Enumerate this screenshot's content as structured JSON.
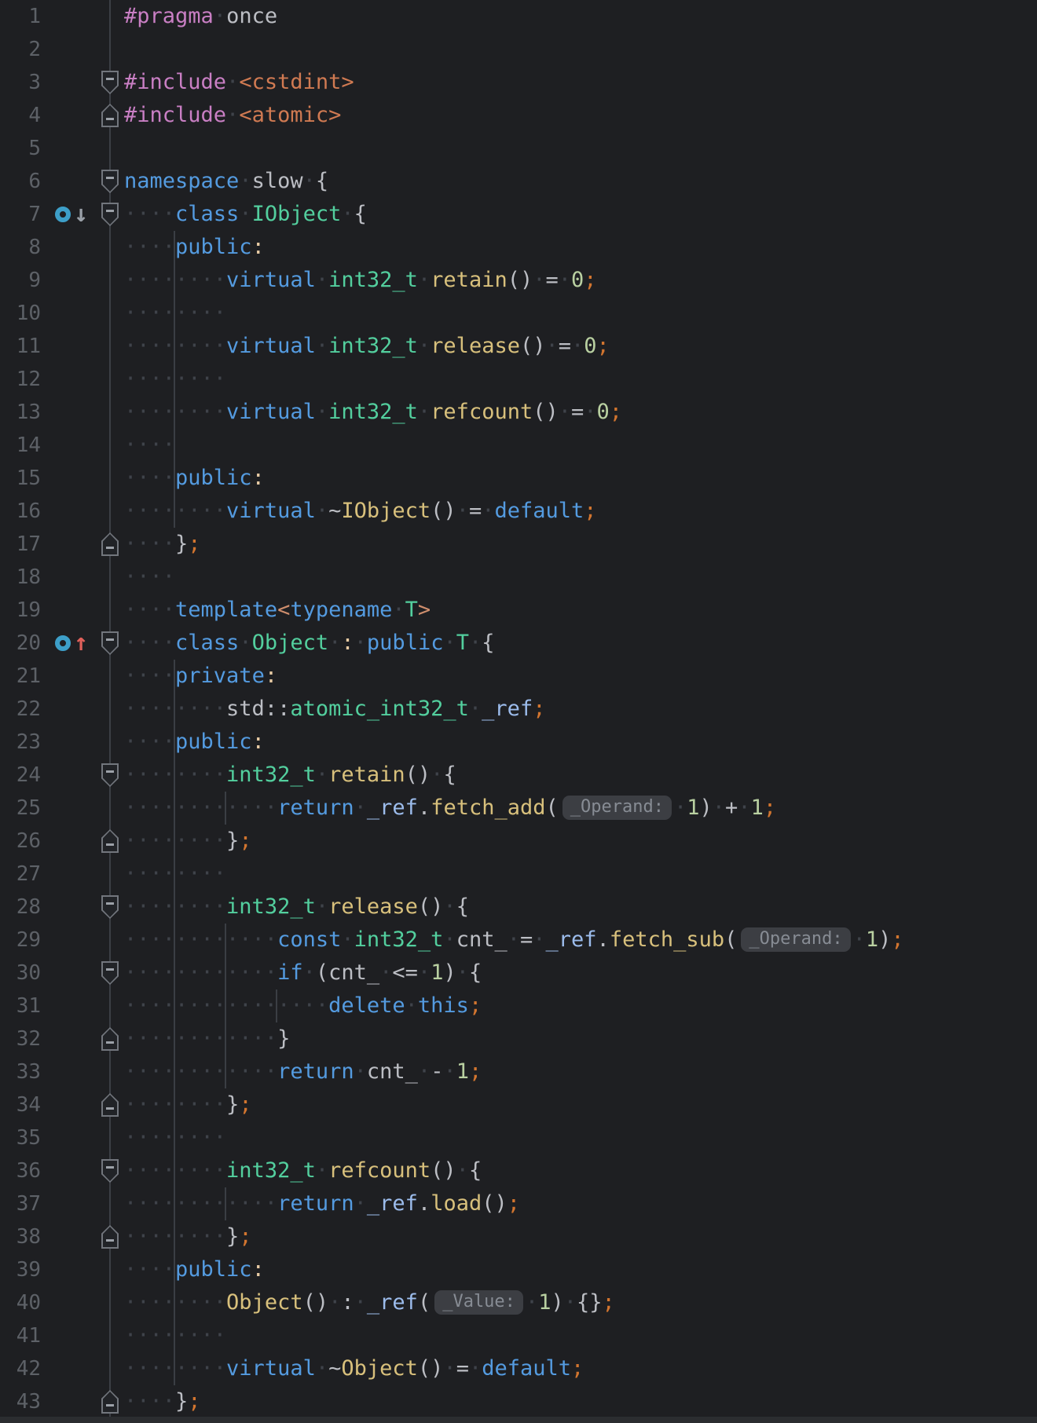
{
  "editor": {
    "background": "#1e1f22",
    "token_colors": {
      "def": "#bcbec4",
      "kw": "#549be0",
      "ty": "#53cf9e",
      "fn": "#d8c07c",
      "fi": "#9cbcec",
      "pp": "#c97fc4",
      "inc": "#d07a52",
      "num": "#b9d0a1",
      "semi": "#d2752f",
      "pun": "#e8cba4",
      "ang": "#cf8e6d",
      "ws": "#3f434a"
    },
    "ui_colors": {
      "line_number": "#5d6167",
      "gutter_line": "#3c3f45",
      "indent_guide": "#3a3e44",
      "fold_border": "#72767d",
      "fold_fill": "#212327",
      "fold_minus": "#9ca1a8",
      "hint_bg": "#3c3e43",
      "hint_fg": "#878c94",
      "implemented_circle": "#3d9fc9",
      "arrow_down": "#9aa0a8",
      "arrow_up": "#e0605a",
      "bottom_bar": "#2b2d30"
    },
    "indent_guides": [
      {
        "col": 4,
        "from": 8,
        "to": 16
      },
      {
        "col": 4,
        "from": 21,
        "to": 42
      },
      {
        "col": 8,
        "from": 25,
        "to": 25
      },
      {
        "col": 8,
        "from": 29,
        "to": 33
      },
      {
        "col": 8,
        "from": 37,
        "to": 37
      },
      {
        "col": 12,
        "from": 31,
        "to": 31
      }
    ],
    "lines": [
      {
        "n": 1,
        "fold": null,
        "icon": null,
        "tokens": [
          [
            "pp",
            "#pragma"
          ],
          [
            "def",
            " once"
          ]
        ]
      },
      {
        "n": 2,
        "fold": null,
        "icon": null,
        "tokens": []
      },
      {
        "n": 3,
        "fold": "down",
        "icon": null,
        "tokens": [
          [
            "pp",
            "#include"
          ],
          [
            "def",
            " "
          ],
          [
            "inc",
            "<cstdint>"
          ]
        ]
      },
      {
        "n": 4,
        "fold": "up",
        "icon": null,
        "tokens": [
          [
            "pp",
            "#include"
          ],
          [
            "def",
            " "
          ],
          [
            "inc",
            "<atomic>"
          ]
        ]
      },
      {
        "n": 5,
        "fold": null,
        "icon": null,
        "tokens": []
      },
      {
        "n": 6,
        "fold": "down",
        "icon": null,
        "tokens": [
          [
            "kw",
            "namespace"
          ],
          [
            "def",
            " slow {"
          ]
        ]
      },
      {
        "n": 7,
        "fold": "down",
        "icon": "down",
        "tokens": [
          [
            "def",
            "    "
          ],
          [
            "kw",
            "class"
          ],
          [
            "def",
            " "
          ],
          [
            "ty",
            "IObject"
          ],
          [
            "def",
            " {"
          ]
        ]
      },
      {
        "n": 8,
        "fold": null,
        "icon": null,
        "tokens": [
          [
            "def",
            "    "
          ],
          [
            "kw",
            "public"
          ],
          [
            "pun",
            ":"
          ]
        ]
      },
      {
        "n": 9,
        "fold": null,
        "icon": null,
        "tokens": [
          [
            "def",
            "        "
          ],
          [
            "kw",
            "virtual"
          ],
          [
            "def",
            " "
          ],
          [
            "ty",
            "int32_t"
          ],
          [
            "def",
            " "
          ],
          [
            "fn",
            "retain"
          ],
          [
            "def",
            "() = "
          ],
          [
            "num",
            "0"
          ],
          [
            "semi",
            ";"
          ]
        ]
      },
      {
        "n": 10,
        "fold": null,
        "icon": null,
        "tokens": [
          [
            "def",
            "        "
          ]
        ]
      },
      {
        "n": 11,
        "fold": null,
        "icon": null,
        "tokens": [
          [
            "def",
            "        "
          ],
          [
            "kw",
            "virtual"
          ],
          [
            "def",
            " "
          ],
          [
            "ty",
            "int32_t"
          ],
          [
            "def",
            " "
          ],
          [
            "fn",
            "release"
          ],
          [
            "def",
            "() = "
          ],
          [
            "num",
            "0"
          ],
          [
            "semi",
            ";"
          ]
        ]
      },
      {
        "n": 12,
        "fold": null,
        "icon": null,
        "tokens": [
          [
            "def",
            "        "
          ]
        ]
      },
      {
        "n": 13,
        "fold": null,
        "icon": null,
        "tokens": [
          [
            "def",
            "        "
          ],
          [
            "kw",
            "virtual"
          ],
          [
            "def",
            " "
          ],
          [
            "ty",
            "int32_t"
          ],
          [
            "def",
            " "
          ],
          [
            "fn",
            "refcount"
          ],
          [
            "def",
            "() = "
          ],
          [
            "num",
            "0"
          ],
          [
            "semi",
            ";"
          ]
        ]
      },
      {
        "n": 14,
        "fold": null,
        "icon": null,
        "tokens": [
          [
            "def",
            "    "
          ]
        ]
      },
      {
        "n": 15,
        "fold": null,
        "icon": null,
        "tokens": [
          [
            "def",
            "    "
          ],
          [
            "kw",
            "public"
          ],
          [
            "pun",
            ":"
          ]
        ]
      },
      {
        "n": 16,
        "fold": null,
        "icon": null,
        "tokens": [
          [
            "def",
            "        "
          ],
          [
            "kw",
            "virtual"
          ],
          [
            "def",
            " ~"
          ],
          [
            "fn",
            "IObject"
          ],
          [
            "def",
            "() = "
          ],
          [
            "kw",
            "default"
          ],
          [
            "semi",
            ";"
          ]
        ]
      },
      {
        "n": 17,
        "fold": "up",
        "icon": null,
        "tokens": [
          [
            "def",
            "    }"
          ],
          [
            "semi",
            ";"
          ]
        ]
      },
      {
        "n": 18,
        "fold": null,
        "icon": null,
        "tokens": [
          [
            "def",
            "    "
          ]
        ]
      },
      {
        "n": 19,
        "fold": null,
        "icon": null,
        "tokens": [
          [
            "def",
            "    "
          ],
          [
            "kw",
            "template"
          ],
          [
            "ang",
            "<"
          ],
          [
            "kw",
            "typename"
          ],
          [
            "def",
            " "
          ],
          [
            "ty",
            "T"
          ],
          [
            "ang",
            ">"
          ]
        ]
      },
      {
        "n": 20,
        "fold": "down",
        "icon": "up",
        "tokens": [
          [
            "def",
            "    "
          ],
          [
            "kw",
            "class"
          ],
          [
            "def",
            " "
          ],
          [
            "ty",
            "Object"
          ],
          [
            "def",
            " "
          ],
          [
            "pun",
            ":"
          ],
          [
            "def",
            " "
          ],
          [
            "kw",
            "public"
          ],
          [
            "def",
            " "
          ],
          [
            "ty",
            "T"
          ],
          [
            "def",
            " {"
          ]
        ]
      },
      {
        "n": 21,
        "fold": null,
        "icon": null,
        "tokens": [
          [
            "def",
            "    "
          ],
          [
            "kw",
            "private"
          ],
          [
            "pun",
            ":"
          ]
        ]
      },
      {
        "n": 22,
        "fold": null,
        "icon": null,
        "tokens": [
          [
            "def",
            "        std::"
          ],
          [
            "ty",
            "atomic_int32_t"
          ],
          [
            "def",
            " "
          ],
          [
            "fi",
            "_ref"
          ],
          [
            "semi",
            ";"
          ]
        ]
      },
      {
        "n": 23,
        "fold": null,
        "icon": null,
        "tokens": [
          [
            "def",
            "    "
          ],
          [
            "kw",
            "public"
          ],
          [
            "pun",
            ":"
          ]
        ]
      },
      {
        "n": 24,
        "fold": "down",
        "icon": null,
        "tokens": [
          [
            "def",
            "        "
          ],
          [
            "ty",
            "int32_t"
          ],
          [
            "def",
            " "
          ],
          [
            "fn",
            "retain"
          ],
          [
            "def",
            "() {"
          ]
        ]
      },
      {
        "n": 25,
        "fold": null,
        "icon": null,
        "tokens": [
          [
            "def",
            "            "
          ],
          [
            "kw",
            "return"
          ],
          [
            "def",
            " "
          ],
          [
            "fi",
            "_ref"
          ],
          [
            "def",
            "."
          ],
          [
            "fn",
            "fetch_add"
          ],
          [
            "def",
            "("
          ],
          [
            "hint",
            "_Operand:"
          ],
          [
            "def",
            " "
          ],
          [
            "num",
            "1"
          ],
          [
            "def",
            ") + "
          ],
          [
            "num",
            "1"
          ],
          [
            "semi",
            ";"
          ]
        ]
      },
      {
        "n": 26,
        "fold": "up",
        "icon": null,
        "tokens": [
          [
            "def",
            "        }"
          ],
          [
            "semi",
            ";"
          ]
        ]
      },
      {
        "n": 27,
        "fold": null,
        "icon": null,
        "tokens": [
          [
            "def",
            "        "
          ]
        ]
      },
      {
        "n": 28,
        "fold": "down",
        "icon": null,
        "tokens": [
          [
            "def",
            "        "
          ],
          [
            "ty",
            "int32_t"
          ],
          [
            "def",
            " "
          ],
          [
            "fn",
            "release"
          ],
          [
            "def",
            "() {"
          ]
        ]
      },
      {
        "n": 29,
        "fold": null,
        "icon": null,
        "tokens": [
          [
            "def",
            "            "
          ],
          [
            "kw",
            "const"
          ],
          [
            "def",
            " "
          ],
          [
            "ty",
            "int32_t"
          ],
          [
            "def",
            " cnt_ = "
          ],
          [
            "fi",
            "_ref"
          ],
          [
            "def",
            "."
          ],
          [
            "fn",
            "fetch_sub"
          ],
          [
            "def",
            "("
          ],
          [
            "hint",
            "_Operand:"
          ],
          [
            "def",
            " "
          ],
          [
            "num",
            "1"
          ],
          [
            "def",
            ")"
          ],
          [
            "semi",
            ";"
          ]
        ]
      },
      {
        "n": 30,
        "fold": "down",
        "icon": null,
        "tokens": [
          [
            "def",
            "            "
          ],
          [
            "kw",
            "if"
          ],
          [
            "def",
            " (cnt_ <= "
          ],
          [
            "num",
            "1"
          ],
          [
            "def",
            ") {"
          ]
        ]
      },
      {
        "n": 31,
        "fold": null,
        "icon": null,
        "tokens": [
          [
            "def",
            "                "
          ],
          [
            "kw",
            "delete"
          ],
          [
            "def",
            " "
          ],
          [
            "kw",
            "this"
          ],
          [
            "semi",
            ";"
          ]
        ]
      },
      {
        "n": 32,
        "fold": "up",
        "icon": null,
        "tokens": [
          [
            "def",
            "            }"
          ]
        ]
      },
      {
        "n": 33,
        "fold": null,
        "icon": null,
        "tokens": [
          [
            "def",
            "            "
          ],
          [
            "kw",
            "return"
          ],
          [
            "def",
            " cnt_ - "
          ],
          [
            "num",
            "1"
          ],
          [
            "semi",
            ";"
          ]
        ]
      },
      {
        "n": 34,
        "fold": "up",
        "icon": null,
        "tokens": [
          [
            "def",
            "        }"
          ],
          [
            "semi",
            ";"
          ]
        ]
      },
      {
        "n": 35,
        "fold": null,
        "icon": null,
        "tokens": [
          [
            "def",
            "        "
          ]
        ]
      },
      {
        "n": 36,
        "fold": "down",
        "icon": null,
        "tokens": [
          [
            "def",
            "        "
          ],
          [
            "ty",
            "int32_t"
          ],
          [
            "def",
            " "
          ],
          [
            "fn",
            "refcount"
          ],
          [
            "def",
            "() {"
          ]
        ]
      },
      {
        "n": 37,
        "fold": null,
        "icon": null,
        "tokens": [
          [
            "def",
            "            "
          ],
          [
            "kw",
            "return"
          ],
          [
            "def",
            " "
          ],
          [
            "fi",
            "_ref"
          ],
          [
            "def",
            "."
          ],
          [
            "fn",
            "load"
          ],
          [
            "def",
            "()"
          ],
          [
            "semi",
            ";"
          ]
        ]
      },
      {
        "n": 38,
        "fold": "up",
        "icon": null,
        "tokens": [
          [
            "def",
            "        }"
          ],
          [
            "semi",
            ";"
          ]
        ]
      },
      {
        "n": 39,
        "fold": null,
        "icon": null,
        "tokens": [
          [
            "def",
            "    "
          ],
          [
            "kw",
            "public"
          ],
          [
            "pun",
            ":"
          ]
        ]
      },
      {
        "n": 40,
        "fold": null,
        "icon": null,
        "tokens": [
          [
            "def",
            "        "
          ],
          [
            "fn",
            "Object"
          ],
          [
            "def",
            "() : "
          ],
          [
            "fi",
            "_ref"
          ],
          [
            "def",
            "("
          ],
          [
            "hint",
            "_Value:"
          ],
          [
            "def",
            " "
          ],
          [
            "num",
            "1"
          ],
          [
            "def",
            ") {}"
          ],
          [
            "semi",
            ";"
          ]
        ]
      },
      {
        "n": 41,
        "fold": null,
        "icon": null,
        "tokens": [
          [
            "def",
            "        "
          ]
        ]
      },
      {
        "n": 42,
        "fold": null,
        "icon": null,
        "tokens": [
          [
            "def",
            "        "
          ],
          [
            "kw",
            "virtual"
          ],
          [
            "def",
            " ~"
          ],
          [
            "fn",
            "Object"
          ],
          [
            "def",
            "() = "
          ],
          [
            "kw",
            "default"
          ],
          [
            "semi",
            ";"
          ]
        ]
      },
      {
        "n": 43,
        "fold": "up",
        "icon": null,
        "tokens": [
          [
            "def",
            "    }"
          ],
          [
            "semi",
            ";"
          ]
        ]
      }
    ]
  }
}
